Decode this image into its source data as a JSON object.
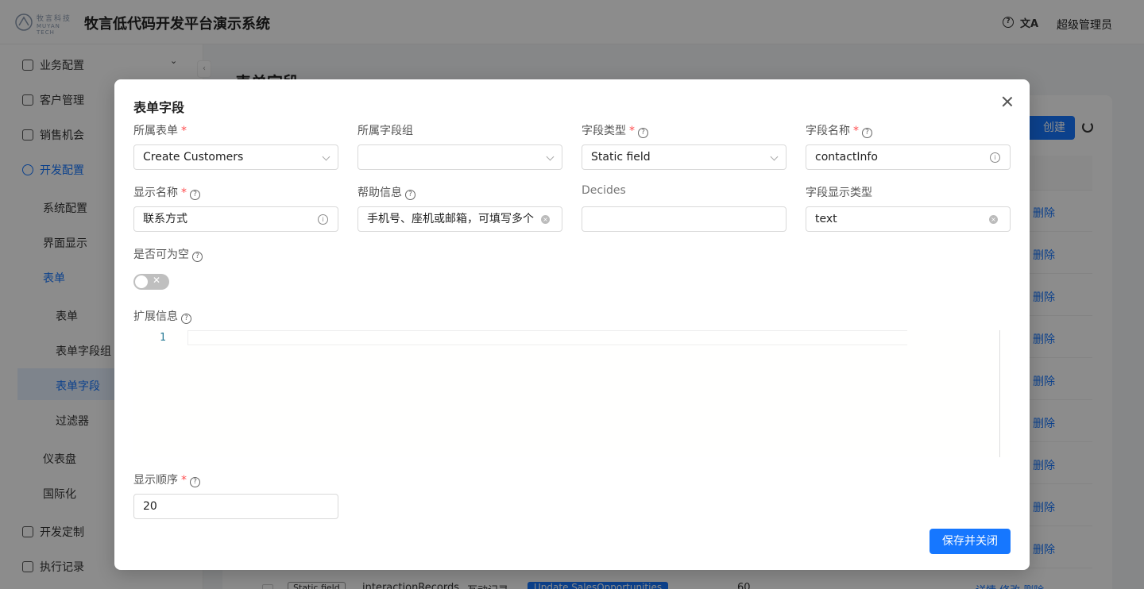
{
  "app": {
    "logo_cn": "牧言科技",
    "logo_en": "MUYAN TECH",
    "title": "牧言低代码开发平台演示系统",
    "help_icon": "question-circle-icon",
    "lang_icon": "translate-icon",
    "user": "超级管理员"
  },
  "sidebar": {
    "items": [
      {
        "label": "业务配置",
        "icon": "cluster-icon"
      },
      {
        "label": "客户管理",
        "icon": "user-icon"
      },
      {
        "label": "销售机会",
        "icon": "chart-icon"
      },
      {
        "label": "开发配置",
        "icon": "gear-icon"
      },
      {
        "label": "系统配置"
      },
      {
        "label": "界面显示"
      },
      {
        "label": "表单"
      },
      {
        "label": "表单"
      },
      {
        "label": "表单字段组"
      },
      {
        "label": "表单字段"
      },
      {
        "label": "过滤器"
      },
      {
        "label": "仪表盘"
      },
      {
        "label": "国际化"
      },
      {
        "label": "开发定制",
        "icon": "rocket-icon"
      },
      {
        "label": "执行记录",
        "icon": "record-icon"
      }
    ]
  },
  "main": {
    "title": "表单字段",
    "create_label": "创建",
    "delete_label": "删除",
    "bottom_row": {
      "type": "Static field",
      "name": "interactionRecords",
      "label": "互动记录",
      "form": "Update SalesOpportunities",
      "order": "60",
      "actions": "详情 修改 删除"
    }
  },
  "modal": {
    "title": "表单字段",
    "fields": {
      "form": {
        "label": "所属表单",
        "value": "Create Customers"
      },
      "group": {
        "label": "所属字段组",
        "value": ""
      },
      "type": {
        "label": "字段类型",
        "value": "Static field"
      },
      "name": {
        "label": "字段名称",
        "value": "contactInfo"
      },
      "display_name": {
        "label": "显示名称",
        "value": "联系方式"
      },
      "help": {
        "label": "帮助信息",
        "value": "手机号、座机或邮箱，可填写多个"
      },
      "decides": {
        "label": "Decides",
        "value": ""
      },
      "display_type": {
        "label": "字段显示类型",
        "value": "text"
      },
      "nullable": {
        "label": "是否可为空",
        "value": false
      },
      "ext": {
        "label": "扩展信息",
        "line_number": "1"
      },
      "order": {
        "label": "显示顺序",
        "value": "20"
      }
    },
    "save_label": "保存并关闭"
  },
  "colors": {
    "primary": "#1677ff",
    "required": "#ff4d4f"
  }
}
